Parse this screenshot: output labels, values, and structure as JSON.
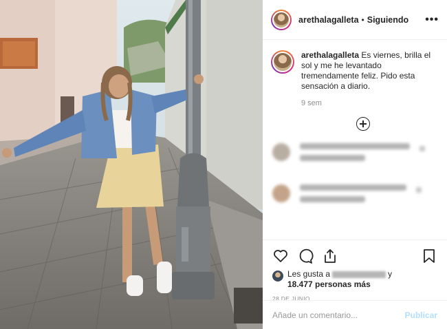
{
  "post": {
    "author": {
      "username": "arethalagalleta",
      "follow_status": "Siguiendo",
      "separator": "•"
    },
    "caption": {
      "username": "arethalagalleta",
      "text": "Es viernes, brilla el sol y me he levantado tremendamente feliz. Pido esta sensación a diario.",
      "age": "9 sem"
    },
    "icons": {
      "avatar": "avatar",
      "more": "more-options-icon",
      "load_more": "load-more-comments-icon",
      "like": "heart-icon",
      "comment": "comment-icon",
      "share": "share-icon",
      "save": "bookmark-icon"
    },
    "more_label": "•••",
    "likes": {
      "prefix": "Les gusta a",
      "connector": "y",
      "count_text": "18.477 personas más"
    },
    "date": "28 DE JUNIO",
    "comment_box": {
      "placeholder": "Añade un comentario...",
      "publish_label": "Publicar"
    },
    "colors": {
      "text": "#262626",
      "muted": "#8e8e8e",
      "publish_disabled": "#b2dffc",
      "border": "#efefef"
    }
  }
}
